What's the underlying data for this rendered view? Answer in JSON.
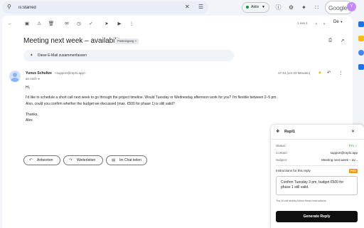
{
  "search": {
    "value": "is:starred"
  },
  "status": {
    "label": "Aktiv"
  },
  "brand": {
    "google": "Google",
    "account_initial": "Y"
  },
  "toolbar": {
    "pager": "1 von 1",
    "lang": "De"
  },
  "email": {
    "subject": "Meeting next week – availability",
    "label": "Posteingang ×",
    "summarize": "Diese E-Mail zusammenfassen",
    "sender_name": "Yunus Schultze",
    "sender_email": "<support@repl1.app>",
    "to": "an mich",
    "time": "17:44 (vor 23 Minuten)",
    "body": [
      "Hi,",
      "I'd like to schedule a short call next week to go through the project timeline. Would Tuesday or Wednesday afternoon work for you? I'm flexible between 2–5 pm.",
      "Also, could you confirm whether the budget we discussed (max. €500 for phase 1) is still valid?",
      "Thanks,",
      "Alex"
    ]
  },
  "actions": {
    "reply": "Antworten",
    "forward": "Weiterleiten",
    "chat": "Im Chat teilen"
  },
  "panel": {
    "title": "Repl1",
    "status_label": "Status:",
    "status_value": "Pro",
    "contact_label": "Contact:",
    "contact_value": "support@repl1.app",
    "subject_label": "Subject:",
    "subject_value": "Meeting next week – av...",
    "instructions_label": "Instructions for this reply",
    "pro_badge": "PRO",
    "instructions_value": "Confirm Tuesday 3 pm, budget €500 for phase 1 still valid.",
    "hint": "The AI will strictly follow these instructions.",
    "generate": "Generate Reply"
  },
  "colors": {
    "accent_dark": "#0f0f0f",
    "pro_green": "#2e9b3c",
    "pro_badge": "#f29900",
    "status_dot": "#1e8e3e"
  }
}
